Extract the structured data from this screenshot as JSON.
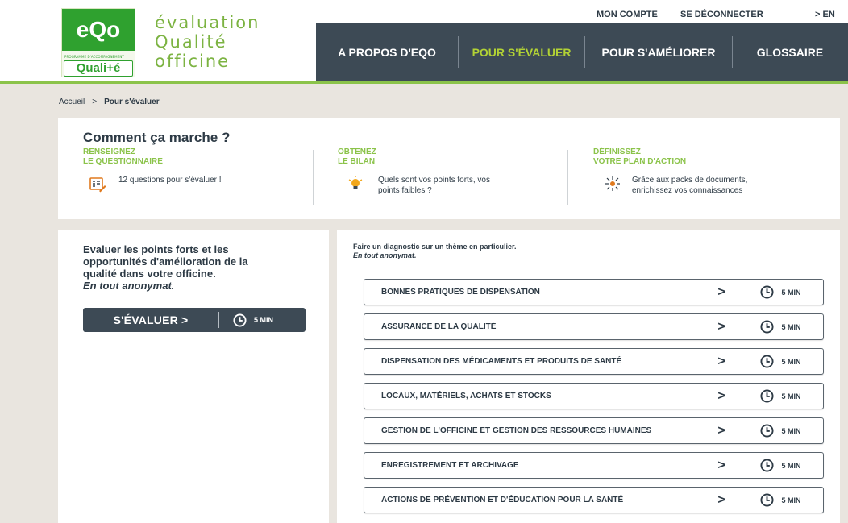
{
  "logo": {
    "mark": "eQo",
    "program_text": "PROGRAMME D'ACCOMPAGNEMENT",
    "sub_mark": "Quali+é"
  },
  "brand": {
    "line1": "évaluation",
    "line2": "Qualité",
    "line3": "officine"
  },
  "topbar": {
    "account": "MON COMPTE",
    "logout": "SE DÉCONNECTER",
    "language": "> EN"
  },
  "nav": {
    "items": [
      {
        "label": "A PROPOS D'EQO",
        "active": false
      },
      {
        "label": "POUR S'ÉVALUER",
        "active": true
      },
      {
        "label": "POUR S'AMÉLIORER",
        "active": false
      },
      {
        "label": "GLOSSAIRE",
        "active": false
      }
    ]
  },
  "breadcrumb": {
    "home": "Accueil",
    "separator": ">",
    "current": "Pour s'évaluer"
  },
  "how": {
    "title": "Comment ça marche ?",
    "steps": [
      {
        "heading1": "RENSEIGNEZ",
        "heading2": "LE QUESTIONNAIRE",
        "text1": "12 questions pour s'évaluer !",
        "text2": "",
        "icon": "questionnaire-icon"
      },
      {
        "heading1": "OBTENEZ",
        "heading2": "LE BILAN",
        "text1": "Quels sont vos points forts, vos",
        "text2": "points faibles ?",
        "icon": "lightbulb-icon"
      },
      {
        "heading1": "DÉFINISSEZ",
        "heading2": "VOTRE PLAN D'ACTION",
        "text1": "Grâce aux packs de documents,",
        "text2": "enrichissez vos connaissances !",
        "icon": "network-icon"
      }
    ]
  },
  "left_card": {
    "line1": "Evaluer les points forts et les",
    "line2": "opportunités d'amélioration de la",
    "line3": "qualité dans votre officine.",
    "line4": "En tout anonymat.",
    "button_label": "S'ÉVALUER  >",
    "button_time": "5 MIN"
  },
  "right_card": {
    "heading": "Faire un diagnostic sur un thème en particulier.",
    "subheading": "En tout anonymat.",
    "themes": [
      {
        "label": "BONNES PRATIQUES DE DISPENSATION",
        "time": "5 MIN"
      },
      {
        "label": "ASSURANCE DE LA QUALITÉ",
        "time": "5 MIN"
      },
      {
        "label": "DISPENSATION DES MÉDICAMENTS ET PRODUITS DE SANTÉ",
        "time": "5 MIN"
      },
      {
        "label": "LOCAUX, MATÉRIELS, ACHATS ET STOCKS",
        "time": "5 MIN"
      },
      {
        "label": "GESTION DE L'OFFICINE ET GESTION DES RESSOURCES HUMAINES",
        "time": "5 MIN"
      },
      {
        "label": "ENREGISTREMENT ET ARCHIVAGE",
        "time": "5 MIN"
      },
      {
        "label": "ACTIONS DE PRÉVENTION ET D'ÉDUCATION POUR LA SANTÉ",
        "time": "5 MIN"
      }
    ],
    "chevron": ">"
  },
  "colors": {
    "accent_green": "#8bc34a",
    "nav_dark": "#3d4a55",
    "nav_active": "#b2d235",
    "brand_green": "#2fa12f"
  }
}
